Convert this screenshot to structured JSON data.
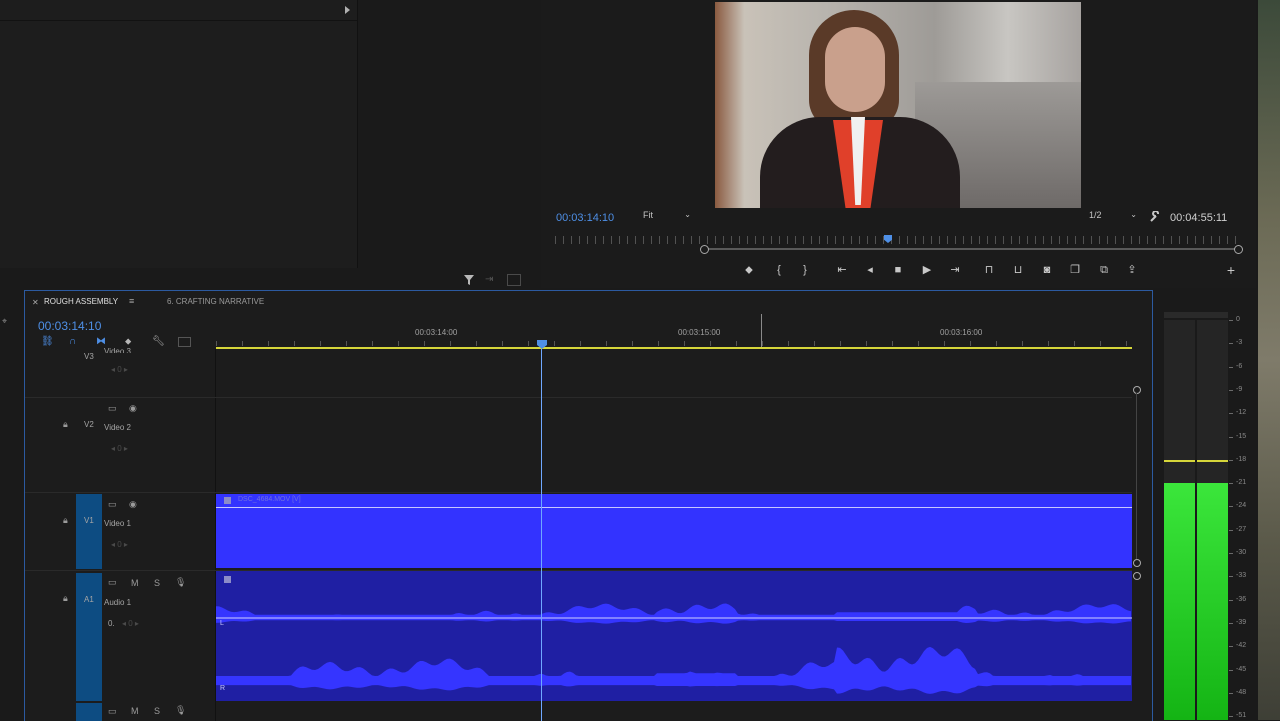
{
  "program_monitor": {
    "current_timecode": "00:03:14:10",
    "zoom": "Fit",
    "resolution": "1/2",
    "duration_timecode": "00:04:55:11"
  },
  "timeline": {
    "tabs": [
      {
        "label": "ROUGH ASSEMBLY",
        "active": true
      },
      {
        "label": "6. CRAFTING NARRATIVE",
        "active": false
      }
    ],
    "current_timecode": "00:03:14:10",
    "ruler_ticks": [
      "00:03:14:00",
      "00:03:15:00",
      "00:03:16:00"
    ],
    "tracks": {
      "v3": {
        "id": "V3",
        "name": "Video 3"
      },
      "v2": {
        "id": "V2",
        "name": "Video 2"
      },
      "v1": {
        "id": "V1",
        "name": "Video 1"
      },
      "a1": {
        "id": "A1",
        "name": "Audio 1",
        "volume": "0."
      }
    },
    "clip_label": "DSC_4684.MOV [V]",
    "channel_left": "L",
    "channel_right": "R",
    "track_buttons": {
      "mute": "M",
      "solo": "S",
      "keyframe_value": "0"
    }
  },
  "vu_meter": {
    "scale": [
      "0",
      "-3",
      "-6",
      "-9",
      "-12",
      "-15",
      "-18",
      "-21",
      "-24",
      "-27",
      "-30",
      "-33",
      "-36",
      "-39",
      "-42",
      "-45",
      "-48",
      "-51"
    ],
    "level_db": -21,
    "peak_db": -18
  },
  "colors": {
    "accent": "#4e8fe6",
    "clip_video": "#3333ff",
    "clip_audio": "#1f1fa3",
    "waveform": "#3535ff",
    "work_area": "#d6d63a",
    "meter_green": "#22d422"
  }
}
